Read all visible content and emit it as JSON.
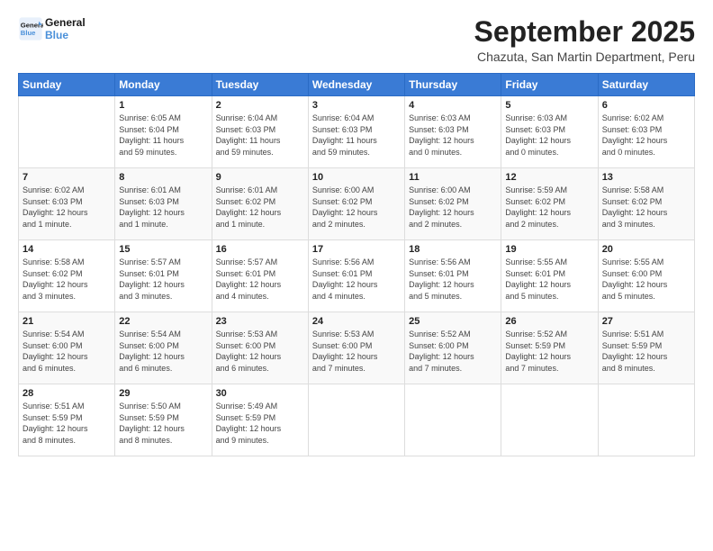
{
  "logo": {
    "line1": "General",
    "line2": "Blue"
  },
  "title": "September 2025",
  "subtitle": "Chazuta, San Martin Department, Peru",
  "days_header": [
    "Sunday",
    "Monday",
    "Tuesday",
    "Wednesday",
    "Thursday",
    "Friday",
    "Saturday"
  ],
  "weeks": [
    [
      {
        "day": "",
        "info": ""
      },
      {
        "day": "1",
        "info": "Sunrise: 6:05 AM\nSunset: 6:04 PM\nDaylight: 11 hours\nand 59 minutes."
      },
      {
        "day": "2",
        "info": "Sunrise: 6:04 AM\nSunset: 6:03 PM\nDaylight: 11 hours\nand 59 minutes."
      },
      {
        "day": "3",
        "info": "Sunrise: 6:04 AM\nSunset: 6:03 PM\nDaylight: 11 hours\nand 59 minutes."
      },
      {
        "day": "4",
        "info": "Sunrise: 6:03 AM\nSunset: 6:03 PM\nDaylight: 12 hours\nand 0 minutes."
      },
      {
        "day": "5",
        "info": "Sunrise: 6:03 AM\nSunset: 6:03 PM\nDaylight: 12 hours\nand 0 minutes."
      },
      {
        "day": "6",
        "info": "Sunrise: 6:02 AM\nSunset: 6:03 PM\nDaylight: 12 hours\nand 0 minutes."
      }
    ],
    [
      {
        "day": "7",
        "info": "Sunrise: 6:02 AM\nSunset: 6:03 PM\nDaylight: 12 hours\nand 1 minute."
      },
      {
        "day": "8",
        "info": "Sunrise: 6:01 AM\nSunset: 6:03 PM\nDaylight: 12 hours\nand 1 minute."
      },
      {
        "day": "9",
        "info": "Sunrise: 6:01 AM\nSunset: 6:02 PM\nDaylight: 12 hours\nand 1 minute."
      },
      {
        "day": "10",
        "info": "Sunrise: 6:00 AM\nSunset: 6:02 PM\nDaylight: 12 hours\nand 2 minutes."
      },
      {
        "day": "11",
        "info": "Sunrise: 6:00 AM\nSunset: 6:02 PM\nDaylight: 12 hours\nand 2 minutes."
      },
      {
        "day": "12",
        "info": "Sunrise: 5:59 AM\nSunset: 6:02 PM\nDaylight: 12 hours\nand 2 minutes."
      },
      {
        "day": "13",
        "info": "Sunrise: 5:58 AM\nSunset: 6:02 PM\nDaylight: 12 hours\nand 3 minutes."
      }
    ],
    [
      {
        "day": "14",
        "info": "Sunrise: 5:58 AM\nSunset: 6:02 PM\nDaylight: 12 hours\nand 3 minutes."
      },
      {
        "day": "15",
        "info": "Sunrise: 5:57 AM\nSunset: 6:01 PM\nDaylight: 12 hours\nand 3 minutes."
      },
      {
        "day": "16",
        "info": "Sunrise: 5:57 AM\nSunset: 6:01 PM\nDaylight: 12 hours\nand 4 minutes."
      },
      {
        "day": "17",
        "info": "Sunrise: 5:56 AM\nSunset: 6:01 PM\nDaylight: 12 hours\nand 4 minutes."
      },
      {
        "day": "18",
        "info": "Sunrise: 5:56 AM\nSunset: 6:01 PM\nDaylight: 12 hours\nand 5 minutes."
      },
      {
        "day": "19",
        "info": "Sunrise: 5:55 AM\nSunset: 6:01 PM\nDaylight: 12 hours\nand 5 minutes."
      },
      {
        "day": "20",
        "info": "Sunrise: 5:55 AM\nSunset: 6:00 PM\nDaylight: 12 hours\nand 5 minutes."
      }
    ],
    [
      {
        "day": "21",
        "info": "Sunrise: 5:54 AM\nSunset: 6:00 PM\nDaylight: 12 hours\nand 6 minutes."
      },
      {
        "day": "22",
        "info": "Sunrise: 5:54 AM\nSunset: 6:00 PM\nDaylight: 12 hours\nand 6 minutes."
      },
      {
        "day": "23",
        "info": "Sunrise: 5:53 AM\nSunset: 6:00 PM\nDaylight: 12 hours\nand 6 minutes."
      },
      {
        "day": "24",
        "info": "Sunrise: 5:53 AM\nSunset: 6:00 PM\nDaylight: 12 hours\nand 7 minutes."
      },
      {
        "day": "25",
        "info": "Sunrise: 5:52 AM\nSunset: 6:00 PM\nDaylight: 12 hours\nand 7 minutes."
      },
      {
        "day": "26",
        "info": "Sunrise: 5:52 AM\nSunset: 5:59 PM\nDaylight: 12 hours\nand 7 minutes."
      },
      {
        "day": "27",
        "info": "Sunrise: 5:51 AM\nSunset: 5:59 PM\nDaylight: 12 hours\nand 8 minutes."
      }
    ],
    [
      {
        "day": "28",
        "info": "Sunrise: 5:51 AM\nSunset: 5:59 PM\nDaylight: 12 hours\nand 8 minutes."
      },
      {
        "day": "29",
        "info": "Sunrise: 5:50 AM\nSunset: 5:59 PM\nDaylight: 12 hours\nand 8 minutes."
      },
      {
        "day": "30",
        "info": "Sunrise: 5:49 AM\nSunset: 5:59 PM\nDaylight: 12 hours\nand 9 minutes."
      },
      {
        "day": "",
        "info": ""
      },
      {
        "day": "",
        "info": ""
      },
      {
        "day": "",
        "info": ""
      },
      {
        "day": "",
        "info": ""
      }
    ]
  ]
}
